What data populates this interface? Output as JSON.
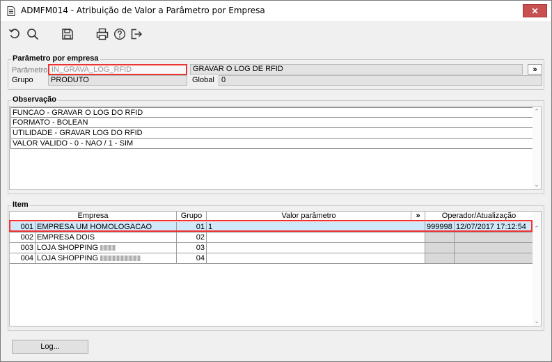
{
  "window": {
    "title": "ADMFM014 - Atribuição de Valor a Parâmetro por Empresa",
    "close_glyph": "✕"
  },
  "toolbar": {
    "icons": [
      "undo-icon",
      "search-icon",
      "save-icon",
      "print-icon",
      "help-icon",
      "exit-icon"
    ]
  },
  "parametro": {
    "legend": "Parâmetro por empresa",
    "param_label": "Parâmetro",
    "param_value": "IN_GRAVA_LOG_RFID",
    "param_desc": "GRAVAR O LOG DE RFID",
    "lookup_label": "»",
    "grupo_label": "Grupo",
    "grupo_value": "PRODUTO",
    "global_label": "Global",
    "global_value": "0"
  },
  "observacao": {
    "legend": "Observação",
    "lines": [
      "FUNCAO - GRAVAR O LOG DO RFID",
      "FORMATO - BOLEAN",
      "UTILIDADE - GRAVAR LOG DO RFID",
      "VALOR VALIDO - 0 - NAO / 1 - SIM"
    ]
  },
  "item": {
    "legend": "Item",
    "headers": {
      "empresa": "Empresa",
      "grupo": "Grupo",
      "valor": "Valor parâmetro",
      "expand": "»",
      "operador": "Operador/Atualização"
    },
    "rows": [
      {
        "code": "001",
        "empresa": "EMPRESA UM HOMOLOGACAO",
        "grupo": "01",
        "valor": "1",
        "operador": "999998",
        "atualizacao": "12/07/2017 17:12:54"
      },
      {
        "code": "002",
        "empresa": "EMPRESA DOIS",
        "grupo": "02",
        "valor": "",
        "operador": "",
        "atualizacao": ""
      },
      {
        "code": "003",
        "empresa": "LOJA SHOPPING",
        "grupo": "03",
        "valor": "",
        "operador": "",
        "atualizacao": ""
      },
      {
        "code": "004",
        "empresa": "LOJA SHOPPING",
        "grupo": "04",
        "valor": "",
        "operador": "",
        "atualizacao": ""
      }
    ]
  },
  "footer": {
    "log_button": "Log..."
  },
  "colors": {
    "highlight_border": "#e33333",
    "selected_row": "#cfe8fa",
    "close_button": "#c75050"
  }
}
